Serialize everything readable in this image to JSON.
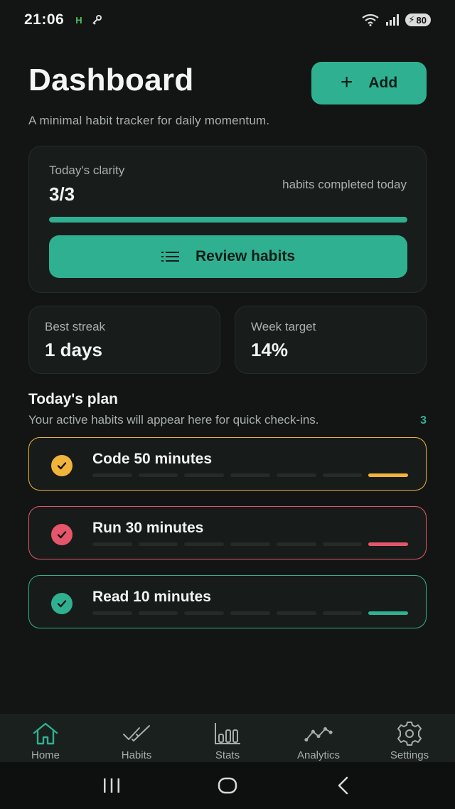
{
  "status_bar": {
    "time": "21:06",
    "indicator": "H",
    "battery": "80"
  },
  "header": {
    "title": "Dashboard",
    "add_label": "Add",
    "subtitle": "A minimal habit tracker for daily momentum."
  },
  "clarity": {
    "label": "Today's clarity",
    "value": "3/3",
    "caption": "habits completed today",
    "progress_fraction": 1.0,
    "review_label": "Review habits"
  },
  "stats": {
    "best_streak_label": "Best streak",
    "best_streak_value": "1 days",
    "week_target_label": "Week target",
    "week_target_value": "14%"
  },
  "plan": {
    "title": "Today's plan",
    "subtitle": "Your active habits will appear here for quick check-ins.",
    "count": "3",
    "habits": [
      {
        "name": "Code 50 minutes",
        "color": "#f0b43a",
        "completed": true,
        "segments_filled": [
          false,
          false,
          false,
          false,
          false,
          false,
          true
        ]
      },
      {
        "name": "Run 30 minutes",
        "color": "#e5566a",
        "completed": true,
        "segments_filled": [
          false,
          false,
          false,
          false,
          false,
          false,
          true
        ]
      },
      {
        "name": "Read 10 minutes",
        "color": "#2fb191",
        "completed": true,
        "segments_filled": [
          false,
          false,
          false,
          false,
          false,
          false,
          true
        ]
      }
    ]
  },
  "nav": {
    "items": [
      {
        "label": "Home",
        "icon": "home-icon",
        "active": true
      },
      {
        "label": "Habits",
        "icon": "double-check-icon",
        "active": false
      },
      {
        "label": "Stats",
        "icon": "bar-chart-icon",
        "active": false
      },
      {
        "label": "Analytics",
        "icon": "line-chart-icon",
        "active": false
      },
      {
        "label": "Settings",
        "icon": "gear-icon",
        "active": false
      }
    ]
  },
  "colors": {
    "accent": "#2fb191",
    "background": "#121513",
    "card": "#181d1b",
    "muted_text": "#a9b0ac"
  }
}
